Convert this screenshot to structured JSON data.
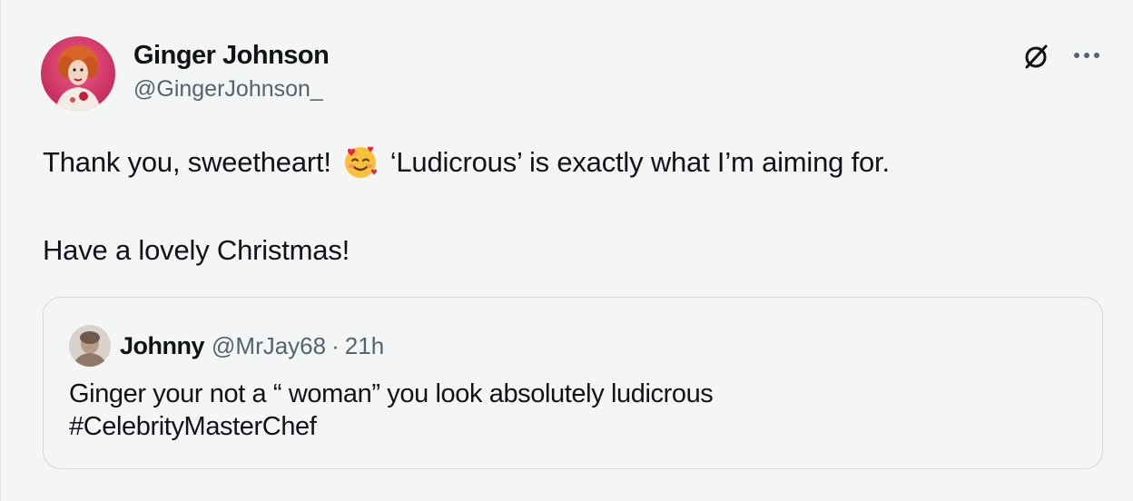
{
  "tweet": {
    "author": {
      "display_name": "Ginger Johnson",
      "handle": "@GingerJohnson_"
    },
    "text_part1": "Thank you, sweetheart!",
    "emoji": "smiling-face-with-hearts-icon",
    "text_part2": "‘Ludicrous’ is exactly what I’m aiming for.",
    "text_line2": "Have a lovely Christmas!",
    "more_label": "···"
  },
  "quote": {
    "author": {
      "display_name": "Johnny",
      "handle": "@MrJay68",
      "separator": "·",
      "time": "21h"
    },
    "text_line1": "Ginger your not a “ woman” you look absolutely ludicrous",
    "text_line2": "#CelebrityMasterChef"
  },
  "colors": {
    "background": "#f4f5f5",
    "text": "#0f1419",
    "secondary_text": "#536471",
    "border": "#cfd9de",
    "avatar_bg": "#d63a6a"
  }
}
